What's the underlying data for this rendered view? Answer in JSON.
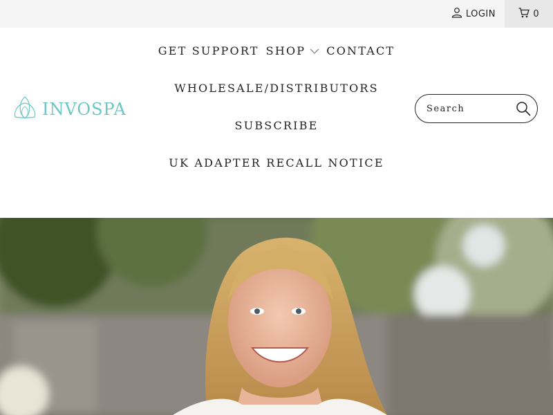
{
  "topbar": {
    "login_label": "LOGIN",
    "cart_count": "0",
    "icons": {
      "user": "user-icon",
      "cart": "cart-icon"
    }
  },
  "logo": {
    "text": "INVOSPA",
    "icon": "lotus-logo-icon",
    "color": "#6cc7c4"
  },
  "nav": {
    "get_support": "GET SUPPORT",
    "shop": "SHOP",
    "contact": "CONTACT",
    "wholesale": "WHOLESALE/DISTRIBUTORS",
    "subscribe": "SUBSCRIBE",
    "recall": "UK ADAPTER RECALL NOTICE",
    "shop_dropdown_icon": "chevron-down-icon"
  },
  "search": {
    "placeholder": "Search",
    "icon": "search-icon"
  },
  "hero": {
    "image": "smiling-woman-outdoors-photo"
  }
}
